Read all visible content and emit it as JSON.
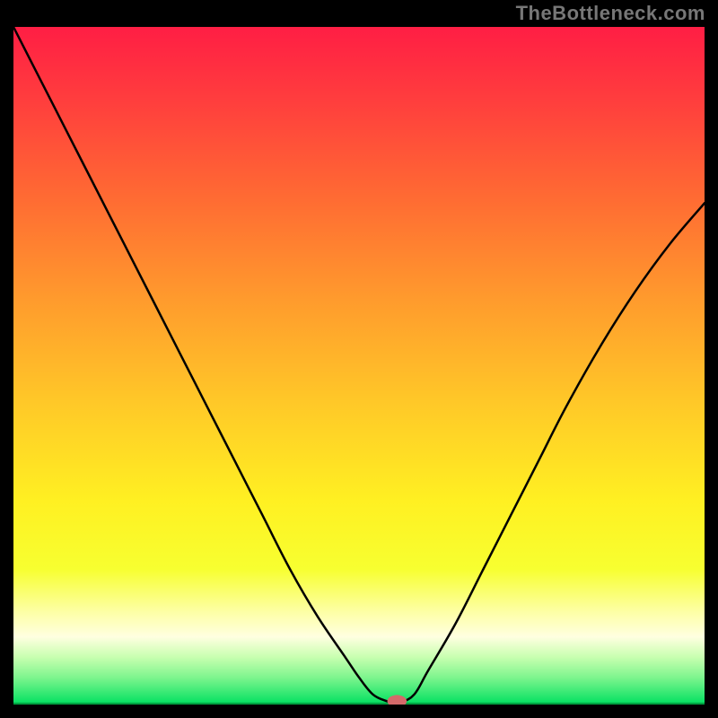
{
  "watermark": "TheBottleneck.com",
  "chart_data": {
    "type": "line",
    "title": "",
    "xlabel": "",
    "ylabel": "",
    "xlim": [
      0,
      100
    ],
    "ylim": [
      0,
      100
    ],
    "legend": false,
    "grid": false,
    "background": {
      "type": "vertical-gradient",
      "stops": [
        {
          "offset": 0.0,
          "color": "#ff1e44"
        },
        {
          "offset": 0.1,
          "color": "#ff3b3e"
        },
        {
          "offset": 0.25,
          "color": "#ff6a33"
        },
        {
          "offset": 0.4,
          "color": "#ff9a2d"
        },
        {
          "offset": 0.55,
          "color": "#ffc728"
        },
        {
          "offset": 0.7,
          "color": "#fff022"
        },
        {
          "offset": 0.8,
          "color": "#f7ff30"
        },
        {
          "offset": 0.86,
          "color": "#fdffa0"
        },
        {
          "offset": 0.9,
          "color": "#ffffe0"
        },
        {
          "offset": 0.93,
          "color": "#c8ffb0"
        },
        {
          "offset": 0.96,
          "color": "#7ef58e"
        },
        {
          "offset": 1.0,
          "color": "#00e060"
        }
      ]
    },
    "series": [
      {
        "name": "bottleneck-curve",
        "color": "#000000",
        "x": [
          0,
          4,
          8,
          12,
          16,
          20,
          24,
          28,
          32,
          36,
          40,
          44,
          48,
          50,
          52,
          54,
          55,
          56,
          58,
          60,
          64,
          68,
          72,
          76,
          80,
          85,
          90,
          95,
          100
        ],
        "y": [
          100,
          92,
          84,
          76,
          68,
          60,
          52,
          44,
          36,
          28,
          20,
          13,
          7,
          4,
          1.5,
          0.5,
          0.3,
          0.3,
          1.5,
          5,
          12,
          20,
          28,
          36,
          44,
          53,
          61,
          68,
          74
        ]
      }
    ],
    "marker": {
      "name": "optimum-point",
      "x": 55.5,
      "y": 0.5,
      "color": "#d46a6a",
      "rx": 1.4,
      "ry": 0.9
    },
    "baseline": {
      "y": 0.15,
      "color": "#00a040"
    }
  }
}
